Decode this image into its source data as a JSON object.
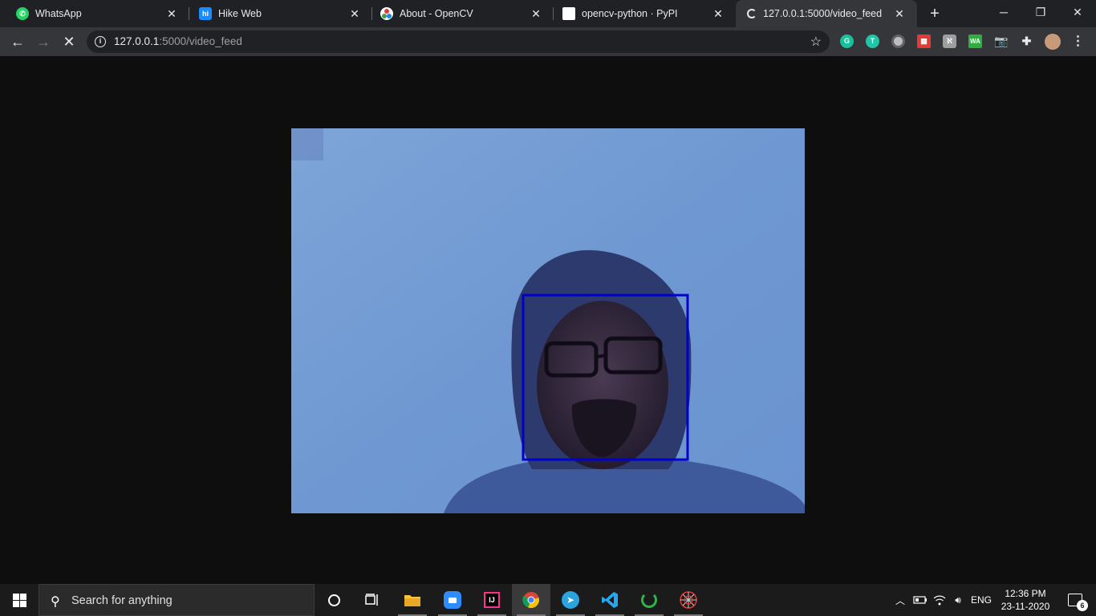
{
  "browser": {
    "tabs": [
      {
        "title": "WhatsApp",
        "icon": "whatsapp-icon",
        "color": "#25d366"
      },
      {
        "title": "Hike Web",
        "icon": "hike-icon",
        "color": "#1a8cff"
      },
      {
        "title": "About - OpenCV",
        "icon": "opencv-icon",
        "color": "#ffffff"
      },
      {
        "title": "opencv-python · PyPI",
        "icon": "pypi-icon",
        "color": "#ffffff"
      },
      {
        "title": "127.0.0.1:5000/video_feed",
        "icon": "loading-icon",
        "color": "#e8eaed"
      }
    ],
    "url_host": "127.0.0.1",
    "url_rest": ":5000/video_feed",
    "extensions": [
      "grammarly-icon",
      "tabnine-icon",
      "circle-ext-icon",
      "red-ext-icon",
      "gray-ext-icon",
      "wa-ext-icon",
      "camera-ext-icon",
      "puzzle-icon",
      "profile-avatar",
      "more-icon"
    ]
  },
  "video": {
    "detection_box_color": "#0000cc"
  },
  "taskbar": {
    "search_placeholder": "Search for anything",
    "apps": [
      "cortana-icon",
      "task-view-icon",
      "file-explorer-icon",
      "zoom-icon",
      "intellij-icon",
      "chrome-icon",
      "telegram-icon",
      "vscode-icon",
      "spinner-app-icon",
      "spider-app-icon"
    ],
    "language": "ENG",
    "time": "12:36 PM",
    "date": "23-11-2020",
    "notification_count": "6"
  }
}
